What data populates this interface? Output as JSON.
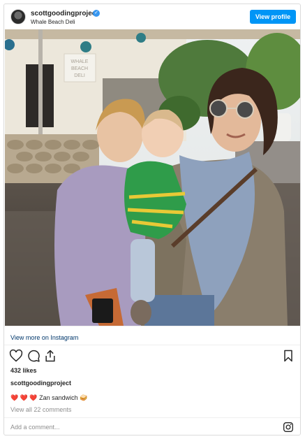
{
  "header": {
    "username": "scottgoodingproject",
    "location": "Whale Beach Deli",
    "view_profile_label": "View profile"
  },
  "photo": {
    "sign_text_line1": "WHALE",
    "sign_text_line2": "BEACH",
    "sign_text_line3": "DELI"
  },
  "view_more_label": "View more on Instagram",
  "icons": {
    "like": "heart-icon",
    "comment": "comment-icon",
    "share": "share-icon",
    "save": "bookmark-icon",
    "instagram": "instagram-icon",
    "verified": "verified-badge-icon"
  },
  "likes_text": "432 likes",
  "caption": {
    "username": "scottgoodingproject",
    "hearts": "❤️ ❤️ ❤️",
    "text": "Zan sandwich 🥪"
  },
  "view_all_comments": "View all 22 comments",
  "comment_placeholder": "Add a comment...",
  "colors": {
    "accent": "#0095f6",
    "link": "#00376b",
    "muted": "#8e8e8e",
    "heart": "#e0245e"
  }
}
